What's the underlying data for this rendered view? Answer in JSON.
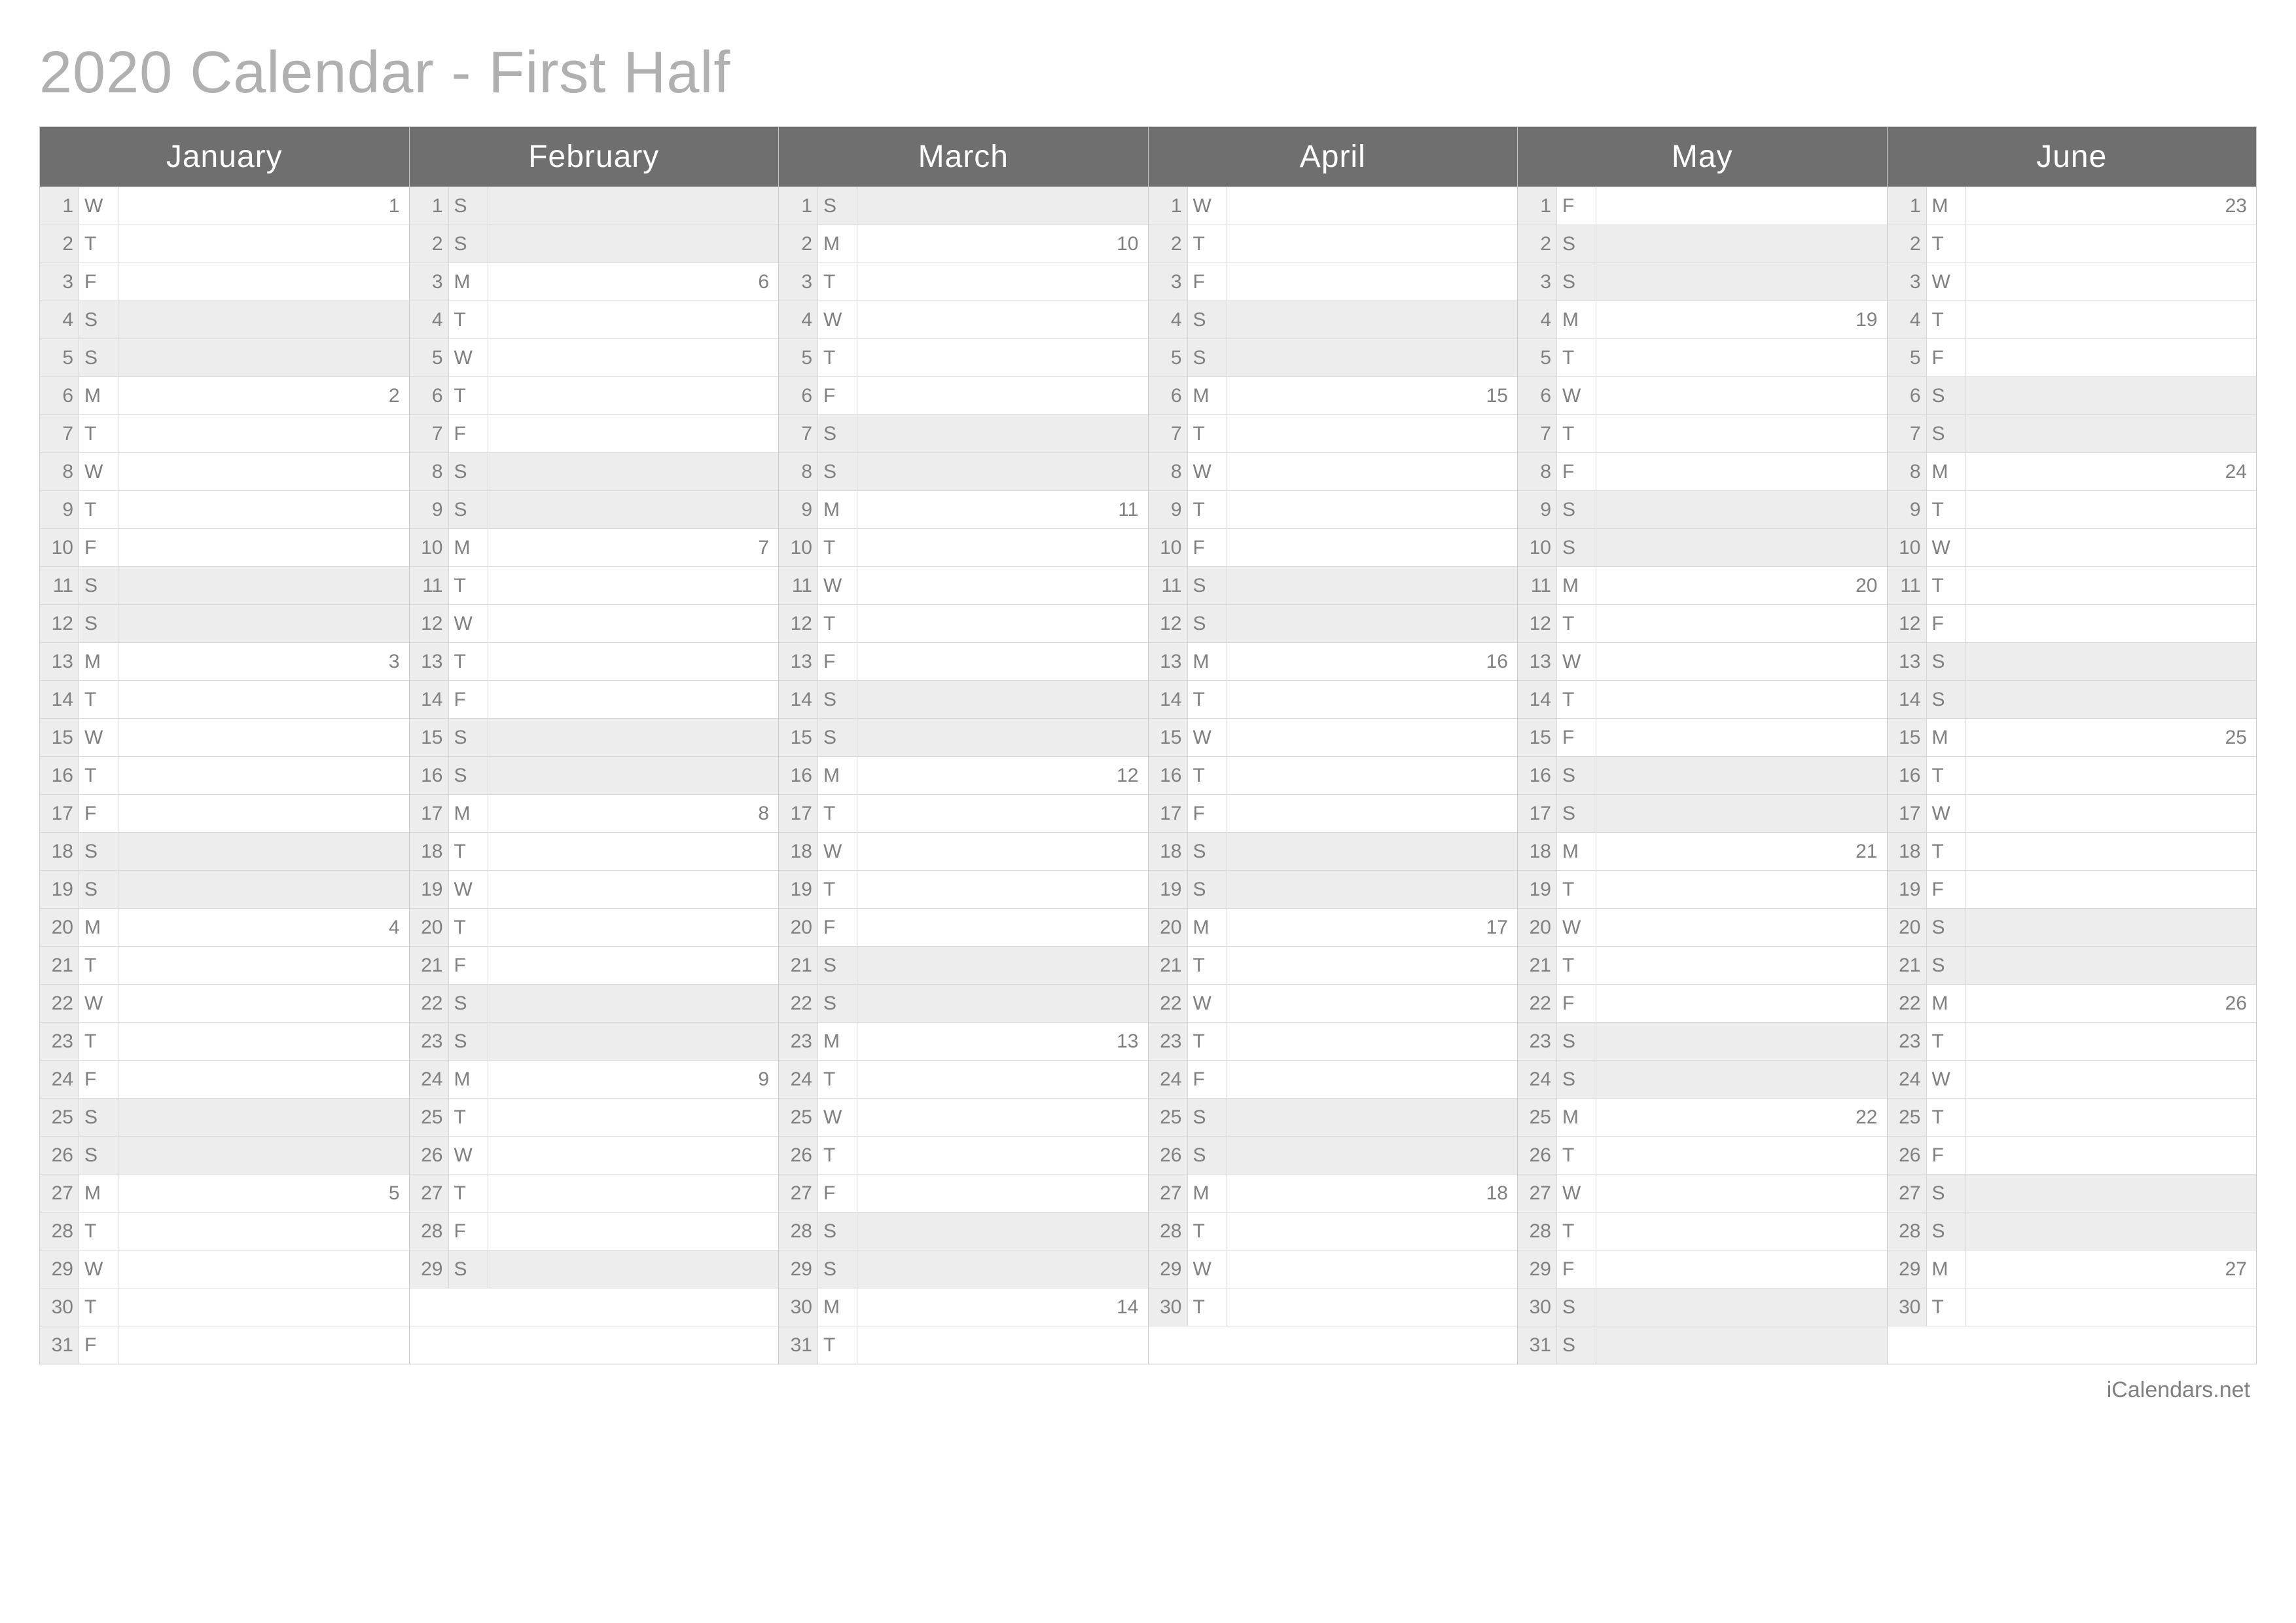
{
  "title": "2020 Calendar - First Half",
  "footer": "iCalendars.net",
  "max_days": 31,
  "months": [
    {
      "name": "January",
      "days": [
        {
          "n": 1,
          "d": "W",
          "w": false,
          "x": "1"
        },
        {
          "n": 2,
          "d": "T",
          "w": false,
          "x": ""
        },
        {
          "n": 3,
          "d": "F",
          "w": false,
          "x": ""
        },
        {
          "n": 4,
          "d": "S",
          "w": true,
          "x": ""
        },
        {
          "n": 5,
          "d": "S",
          "w": true,
          "x": ""
        },
        {
          "n": 6,
          "d": "M",
          "w": false,
          "x": "2"
        },
        {
          "n": 7,
          "d": "T",
          "w": false,
          "x": ""
        },
        {
          "n": 8,
          "d": "W",
          "w": false,
          "x": ""
        },
        {
          "n": 9,
          "d": "T",
          "w": false,
          "x": ""
        },
        {
          "n": 10,
          "d": "F",
          "w": false,
          "x": ""
        },
        {
          "n": 11,
          "d": "S",
          "w": true,
          "x": ""
        },
        {
          "n": 12,
          "d": "S",
          "w": true,
          "x": ""
        },
        {
          "n": 13,
          "d": "M",
          "w": false,
          "x": "3"
        },
        {
          "n": 14,
          "d": "T",
          "w": false,
          "x": ""
        },
        {
          "n": 15,
          "d": "W",
          "w": false,
          "x": ""
        },
        {
          "n": 16,
          "d": "T",
          "w": false,
          "x": ""
        },
        {
          "n": 17,
          "d": "F",
          "w": false,
          "x": ""
        },
        {
          "n": 18,
          "d": "S",
          "w": true,
          "x": ""
        },
        {
          "n": 19,
          "d": "S",
          "w": true,
          "x": ""
        },
        {
          "n": 20,
          "d": "M",
          "w": false,
          "x": "4"
        },
        {
          "n": 21,
          "d": "T",
          "w": false,
          "x": ""
        },
        {
          "n": 22,
          "d": "W",
          "w": false,
          "x": ""
        },
        {
          "n": 23,
          "d": "T",
          "w": false,
          "x": ""
        },
        {
          "n": 24,
          "d": "F",
          "w": false,
          "x": ""
        },
        {
          "n": 25,
          "d": "S",
          "w": true,
          "x": ""
        },
        {
          "n": 26,
          "d": "S",
          "w": true,
          "x": ""
        },
        {
          "n": 27,
          "d": "M",
          "w": false,
          "x": "5"
        },
        {
          "n": 28,
          "d": "T",
          "w": false,
          "x": ""
        },
        {
          "n": 29,
          "d": "W",
          "w": false,
          "x": ""
        },
        {
          "n": 30,
          "d": "T",
          "w": false,
          "x": ""
        },
        {
          "n": 31,
          "d": "F",
          "w": false,
          "x": ""
        }
      ]
    },
    {
      "name": "February",
      "days": [
        {
          "n": 1,
          "d": "S",
          "w": true,
          "x": ""
        },
        {
          "n": 2,
          "d": "S",
          "w": true,
          "x": ""
        },
        {
          "n": 3,
          "d": "M",
          "w": false,
          "x": "6"
        },
        {
          "n": 4,
          "d": "T",
          "w": false,
          "x": ""
        },
        {
          "n": 5,
          "d": "W",
          "w": false,
          "x": ""
        },
        {
          "n": 6,
          "d": "T",
          "w": false,
          "x": ""
        },
        {
          "n": 7,
          "d": "F",
          "w": false,
          "x": ""
        },
        {
          "n": 8,
          "d": "S",
          "w": true,
          "x": ""
        },
        {
          "n": 9,
          "d": "S",
          "w": true,
          "x": ""
        },
        {
          "n": 10,
          "d": "M",
          "w": false,
          "x": "7"
        },
        {
          "n": 11,
          "d": "T",
          "w": false,
          "x": ""
        },
        {
          "n": 12,
          "d": "W",
          "w": false,
          "x": ""
        },
        {
          "n": 13,
          "d": "T",
          "w": false,
          "x": ""
        },
        {
          "n": 14,
          "d": "F",
          "w": false,
          "x": ""
        },
        {
          "n": 15,
          "d": "S",
          "w": true,
          "x": ""
        },
        {
          "n": 16,
          "d": "S",
          "w": true,
          "x": ""
        },
        {
          "n": 17,
          "d": "M",
          "w": false,
          "x": "8"
        },
        {
          "n": 18,
          "d": "T",
          "w": false,
          "x": ""
        },
        {
          "n": 19,
          "d": "W",
          "w": false,
          "x": ""
        },
        {
          "n": 20,
          "d": "T",
          "w": false,
          "x": ""
        },
        {
          "n": 21,
          "d": "F",
          "w": false,
          "x": ""
        },
        {
          "n": 22,
          "d": "S",
          "w": true,
          "x": ""
        },
        {
          "n": 23,
          "d": "S",
          "w": true,
          "x": ""
        },
        {
          "n": 24,
          "d": "M",
          "w": false,
          "x": "9"
        },
        {
          "n": 25,
          "d": "T",
          "w": false,
          "x": ""
        },
        {
          "n": 26,
          "d": "W",
          "w": false,
          "x": ""
        },
        {
          "n": 27,
          "d": "T",
          "w": false,
          "x": ""
        },
        {
          "n": 28,
          "d": "F",
          "w": false,
          "x": ""
        },
        {
          "n": 29,
          "d": "S",
          "w": true,
          "x": ""
        }
      ]
    },
    {
      "name": "March",
      "days": [
        {
          "n": 1,
          "d": "S",
          "w": true,
          "x": ""
        },
        {
          "n": 2,
          "d": "M",
          "w": false,
          "x": "10"
        },
        {
          "n": 3,
          "d": "T",
          "w": false,
          "x": ""
        },
        {
          "n": 4,
          "d": "W",
          "w": false,
          "x": ""
        },
        {
          "n": 5,
          "d": "T",
          "w": false,
          "x": ""
        },
        {
          "n": 6,
          "d": "F",
          "w": false,
          "x": ""
        },
        {
          "n": 7,
          "d": "S",
          "w": true,
          "x": ""
        },
        {
          "n": 8,
          "d": "S",
          "w": true,
          "x": ""
        },
        {
          "n": 9,
          "d": "M",
          "w": false,
          "x": "11"
        },
        {
          "n": 10,
          "d": "T",
          "w": false,
          "x": ""
        },
        {
          "n": 11,
          "d": "W",
          "w": false,
          "x": ""
        },
        {
          "n": 12,
          "d": "T",
          "w": false,
          "x": ""
        },
        {
          "n": 13,
          "d": "F",
          "w": false,
          "x": ""
        },
        {
          "n": 14,
          "d": "S",
          "w": true,
          "x": ""
        },
        {
          "n": 15,
          "d": "S",
          "w": true,
          "x": ""
        },
        {
          "n": 16,
          "d": "M",
          "w": false,
          "x": "12"
        },
        {
          "n": 17,
          "d": "T",
          "w": false,
          "x": ""
        },
        {
          "n": 18,
          "d": "W",
          "w": false,
          "x": ""
        },
        {
          "n": 19,
          "d": "T",
          "w": false,
          "x": ""
        },
        {
          "n": 20,
          "d": "F",
          "w": false,
          "x": ""
        },
        {
          "n": 21,
          "d": "S",
          "w": true,
          "x": ""
        },
        {
          "n": 22,
          "d": "S",
          "w": true,
          "x": ""
        },
        {
          "n": 23,
          "d": "M",
          "w": false,
          "x": "13"
        },
        {
          "n": 24,
          "d": "T",
          "w": false,
          "x": ""
        },
        {
          "n": 25,
          "d": "W",
          "w": false,
          "x": ""
        },
        {
          "n": 26,
          "d": "T",
          "w": false,
          "x": ""
        },
        {
          "n": 27,
          "d": "F",
          "w": false,
          "x": ""
        },
        {
          "n": 28,
          "d": "S",
          "w": true,
          "x": ""
        },
        {
          "n": 29,
          "d": "S",
          "w": true,
          "x": ""
        },
        {
          "n": 30,
          "d": "M",
          "w": false,
          "x": "14"
        },
        {
          "n": 31,
          "d": "T",
          "w": false,
          "x": ""
        }
      ]
    },
    {
      "name": "April",
      "days": [
        {
          "n": 1,
          "d": "W",
          "w": false,
          "x": ""
        },
        {
          "n": 2,
          "d": "T",
          "w": false,
          "x": ""
        },
        {
          "n": 3,
          "d": "F",
          "w": false,
          "x": ""
        },
        {
          "n": 4,
          "d": "S",
          "w": true,
          "x": ""
        },
        {
          "n": 5,
          "d": "S",
          "w": true,
          "x": ""
        },
        {
          "n": 6,
          "d": "M",
          "w": false,
          "x": "15"
        },
        {
          "n": 7,
          "d": "T",
          "w": false,
          "x": ""
        },
        {
          "n": 8,
          "d": "W",
          "w": false,
          "x": ""
        },
        {
          "n": 9,
          "d": "T",
          "w": false,
          "x": ""
        },
        {
          "n": 10,
          "d": "F",
          "w": false,
          "x": ""
        },
        {
          "n": 11,
          "d": "S",
          "w": true,
          "x": ""
        },
        {
          "n": 12,
          "d": "S",
          "w": true,
          "x": ""
        },
        {
          "n": 13,
          "d": "M",
          "w": false,
          "x": "16"
        },
        {
          "n": 14,
          "d": "T",
          "w": false,
          "x": ""
        },
        {
          "n": 15,
          "d": "W",
          "w": false,
          "x": ""
        },
        {
          "n": 16,
          "d": "T",
          "w": false,
          "x": ""
        },
        {
          "n": 17,
          "d": "F",
          "w": false,
          "x": ""
        },
        {
          "n": 18,
          "d": "S",
          "w": true,
          "x": ""
        },
        {
          "n": 19,
          "d": "S",
          "w": true,
          "x": ""
        },
        {
          "n": 20,
          "d": "M",
          "w": false,
          "x": "17"
        },
        {
          "n": 21,
          "d": "T",
          "w": false,
          "x": ""
        },
        {
          "n": 22,
          "d": "W",
          "w": false,
          "x": ""
        },
        {
          "n": 23,
          "d": "T",
          "w": false,
          "x": ""
        },
        {
          "n": 24,
          "d": "F",
          "w": false,
          "x": ""
        },
        {
          "n": 25,
          "d": "S",
          "w": true,
          "x": ""
        },
        {
          "n": 26,
          "d": "S",
          "w": true,
          "x": ""
        },
        {
          "n": 27,
          "d": "M",
          "w": false,
          "x": "18"
        },
        {
          "n": 28,
          "d": "T",
          "w": false,
          "x": ""
        },
        {
          "n": 29,
          "d": "W",
          "w": false,
          "x": ""
        },
        {
          "n": 30,
          "d": "T",
          "w": false,
          "x": ""
        }
      ]
    },
    {
      "name": "May",
      "days": [
        {
          "n": 1,
          "d": "F",
          "w": false,
          "x": ""
        },
        {
          "n": 2,
          "d": "S",
          "w": true,
          "x": ""
        },
        {
          "n": 3,
          "d": "S",
          "w": true,
          "x": ""
        },
        {
          "n": 4,
          "d": "M",
          "w": false,
          "x": "19"
        },
        {
          "n": 5,
          "d": "T",
          "w": false,
          "x": ""
        },
        {
          "n": 6,
          "d": "W",
          "w": false,
          "x": ""
        },
        {
          "n": 7,
          "d": "T",
          "w": false,
          "x": ""
        },
        {
          "n": 8,
          "d": "F",
          "w": false,
          "x": ""
        },
        {
          "n": 9,
          "d": "S",
          "w": true,
          "x": ""
        },
        {
          "n": 10,
          "d": "S",
          "w": true,
          "x": ""
        },
        {
          "n": 11,
          "d": "M",
          "w": false,
          "x": "20"
        },
        {
          "n": 12,
          "d": "T",
          "w": false,
          "x": ""
        },
        {
          "n": 13,
          "d": "W",
          "w": false,
          "x": ""
        },
        {
          "n": 14,
          "d": "T",
          "w": false,
          "x": ""
        },
        {
          "n": 15,
          "d": "F",
          "w": false,
          "x": ""
        },
        {
          "n": 16,
          "d": "S",
          "w": true,
          "x": ""
        },
        {
          "n": 17,
          "d": "S",
          "w": true,
          "x": ""
        },
        {
          "n": 18,
          "d": "M",
          "w": false,
          "x": "21"
        },
        {
          "n": 19,
          "d": "T",
          "w": false,
          "x": ""
        },
        {
          "n": 20,
          "d": "W",
          "w": false,
          "x": ""
        },
        {
          "n": 21,
          "d": "T",
          "w": false,
          "x": ""
        },
        {
          "n": 22,
          "d": "F",
          "w": false,
          "x": ""
        },
        {
          "n": 23,
          "d": "S",
          "w": true,
          "x": ""
        },
        {
          "n": 24,
          "d": "S",
          "w": true,
          "x": ""
        },
        {
          "n": 25,
          "d": "M",
          "w": false,
          "x": "22"
        },
        {
          "n": 26,
          "d": "T",
          "w": false,
          "x": ""
        },
        {
          "n": 27,
          "d": "W",
          "w": false,
          "x": ""
        },
        {
          "n": 28,
          "d": "T",
          "w": false,
          "x": ""
        },
        {
          "n": 29,
          "d": "F",
          "w": false,
          "x": ""
        },
        {
          "n": 30,
          "d": "S",
          "w": true,
          "x": ""
        },
        {
          "n": 31,
          "d": "S",
          "w": true,
          "x": ""
        }
      ]
    },
    {
      "name": "June",
      "days": [
        {
          "n": 1,
          "d": "M",
          "w": false,
          "x": "23"
        },
        {
          "n": 2,
          "d": "T",
          "w": false,
          "x": ""
        },
        {
          "n": 3,
          "d": "W",
          "w": false,
          "x": ""
        },
        {
          "n": 4,
          "d": "T",
          "w": false,
          "x": ""
        },
        {
          "n": 5,
          "d": "F",
          "w": false,
          "x": ""
        },
        {
          "n": 6,
          "d": "S",
          "w": true,
          "x": ""
        },
        {
          "n": 7,
          "d": "S",
          "w": true,
          "x": ""
        },
        {
          "n": 8,
          "d": "M",
          "w": false,
          "x": "24"
        },
        {
          "n": 9,
          "d": "T",
          "w": false,
          "x": ""
        },
        {
          "n": 10,
          "d": "W",
          "w": false,
          "x": ""
        },
        {
          "n": 11,
          "d": "T",
          "w": false,
          "x": ""
        },
        {
          "n": 12,
          "d": "F",
          "w": false,
          "x": ""
        },
        {
          "n": 13,
          "d": "S",
          "w": true,
          "x": ""
        },
        {
          "n": 14,
          "d": "S",
          "w": true,
          "x": ""
        },
        {
          "n": 15,
          "d": "M",
          "w": false,
          "x": "25"
        },
        {
          "n": 16,
          "d": "T",
          "w": false,
          "x": ""
        },
        {
          "n": 17,
          "d": "W",
          "w": false,
          "x": ""
        },
        {
          "n": 18,
          "d": "T",
          "w": false,
          "x": ""
        },
        {
          "n": 19,
          "d": "F",
          "w": false,
          "x": ""
        },
        {
          "n": 20,
          "d": "S",
          "w": true,
          "x": ""
        },
        {
          "n": 21,
          "d": "S",
          "w": true,
          "x": ""
        },
        {
          "n": 22,
          "d": "M",
          "w": false,
          "x": "26"
        },
        {
          "n": 23,
          "d": "T",
          "w": false,
          "x": ""
        },
        {
          "n": 24,
          "d": "W",
          "w": false,
          "x": ""
        },
        {
          "n": 25,
          "d": "T",
          "w": false,
          "x": ""
        },
        {
          "n": 26,
          "d": "F",
          "w": false,
          "x": ""
        },
        {
          "n": 27,
          "d": "S",
          "w": true,
          "x": ""
        },
        {
          "n": 28,
          "d": "S",
          "w": true,
          "x": ""
        },
        {
          "n": 29,
          "d": "M",
          "w": false,
          "x": "27"
        },
        {
          "n": 30,
          "d": "T",
          "w": false,
          "x": ""
        }
      ]
    }
  ]
}
